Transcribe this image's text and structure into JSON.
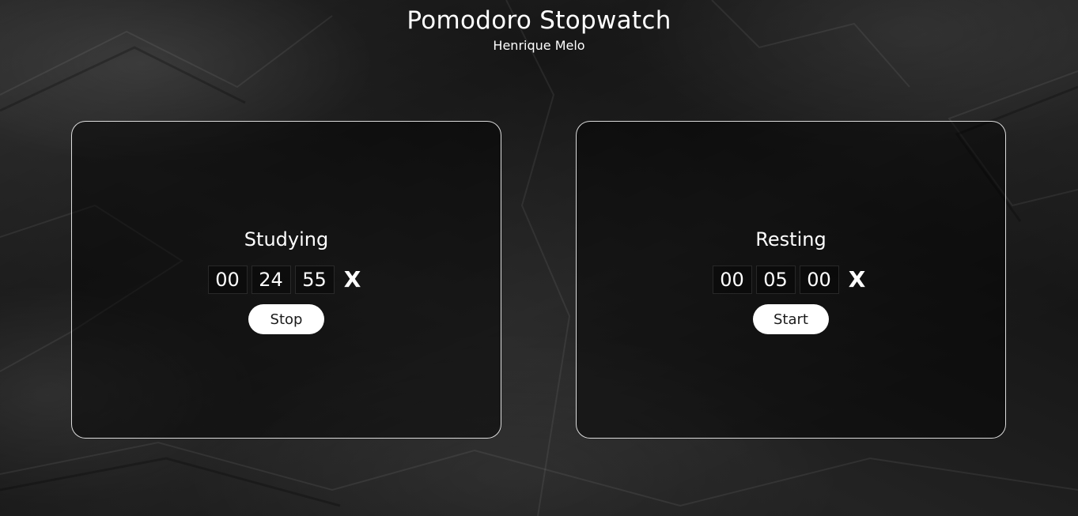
{
  "app": {
    "title": "Pomodoro Stopwatch",
    "author": "Henrique Melo"
  },
  "timers": [
    {
      "label": "Studying",
      "hours": "00",
      "minutes": "24",
      "seconds": "55",
      "reset_label": "X",
      "button_label": "Stop"
    },
    {
      "label": "Resting",
      "hours": "00",
      "minutes": "05",
      "seconds": "00",
      "reset_label": "X",
      "button_label": "Start"
    }
  ],
  "colors": {
    "text": "#ffffff",
    "button_bg": "#ffffff",
    "button_text": "#1a1a1a",
    "panel_border": "#ffffff",
    "background": "#1b1b1b"
  }
}
